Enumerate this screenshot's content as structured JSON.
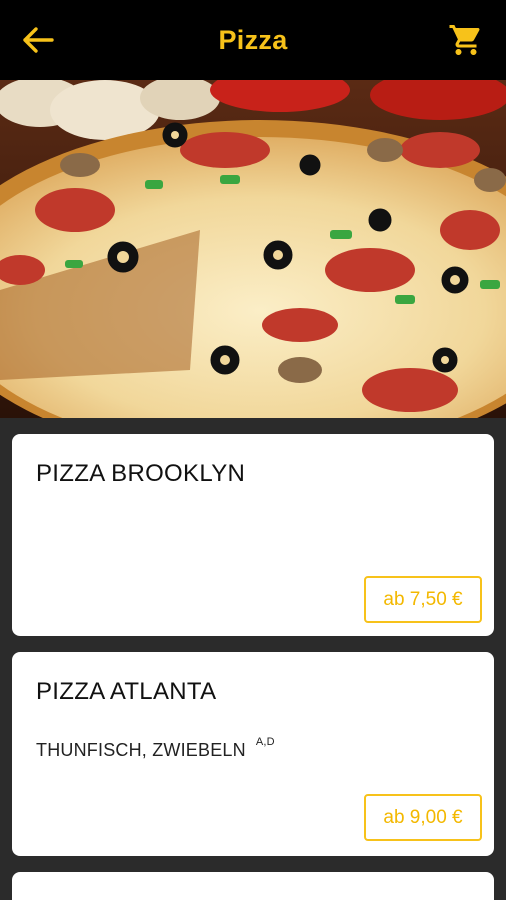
{
  "header": {
    "title": "Pizza",
    "accent_color": "#f7c21a",
    "back_icon": "arrow-left-icon",
    "cart_icon": "shopping-cart-icon"
  },
  "hero": {
    "image": "pizza-photo"
  },
  "items": [
    {
      "name": "PIZZA BROOKLYN",
      "description": "",
      "allergens": "",
      "price": "ab 7,50 €"
    },
    {
      "name": "PIZZA ATLANTA",
      "description": "THUNFISCH, ZWIEBELN",
      "allergens": "A,D",
      "price": "ab 9,00 €"
    }
  ]
}
